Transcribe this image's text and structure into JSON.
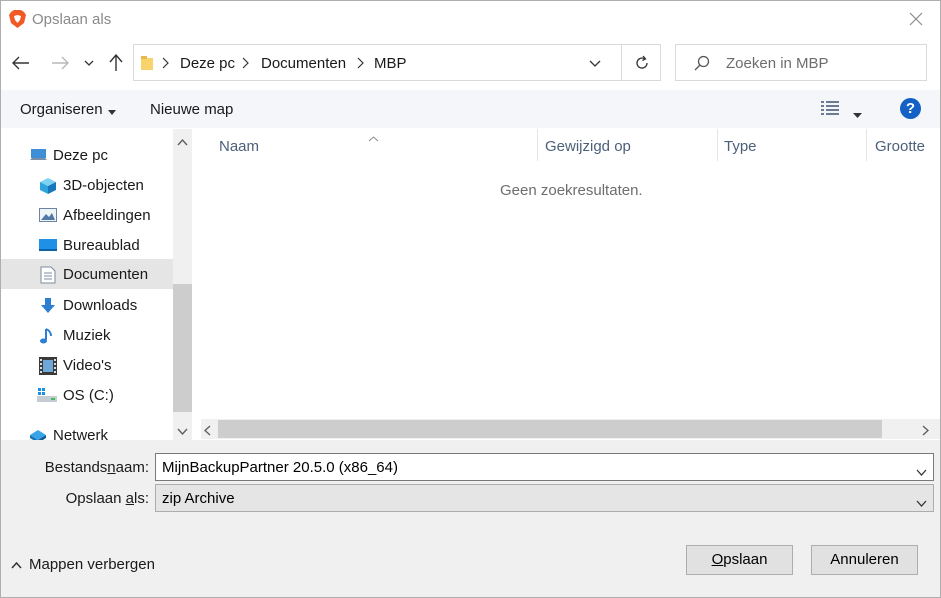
{
  "window": {
    "title": "Opslaan als"
  },
  "breadcrumb": [
    "Deze pc",
    "Documenten",
    "MBP"
  ],
  "search": {
    "placeholder": "Zoeken in MBP"
  },
  "toolbar": {
    "organize_label": "Organiseren",
    "new_folder_label": "Nieuwe map",
    "help_label": "?"
  },
  "nav": {
    "items": [
      {
        "label": "Deze pc",
        "icon": "computer-icon"
      },
      {
        "label": "3D-objecten",
        "icon": "cube-icon"
      },
      {
        "label": "Afbeeldingen",
        "icon": "pictures-icon"
      },
      {
        "label": "Bureaublad",
        "icon": "desktop-icon"
      },
      {
        "label": "Documenten",
        "icon": "document-icon",
        "selected": true
      },
      {
        "label": "Downloads",
        "icon": "download-icon"
      },
      {
        "label": "Muziek",
        "icon": "music-icon"
      },
      {
        "label": "Video's",
        "icon": "video-icon"
      },
      {
        "label": "OS (C:)",
        "icon": "drive-icon"
      },
      {
        "label": "Netwerk",
        "icon": "network-icon"
      }
    ]
  },
  "list": {
    "columns": [
      "Naam",
      "Gewijzigd op",
      "Type",
      "Grootte"
    ],
    "empty_text": "Geen zoekresultaten."
  },
  "form": {
    "filename_label_pre": "Bestands",
    "filename_label_u": "n",
    "filename_label_post": "aam:",
    "filename_value": "MijnBackupPartner 20.5.0 (x86_64)",
    "type_label_pre": "Opslaan ",
    "type_label_u": "a",
    "type_label_post": "ls:",
    "type_value": "zip Archive"
  },
  "footer": {
    "toggle_label": "Mappen verbergen",
    "save_u": "O",
    "save_rest": "pslaan",
    "cancel_label": "Annuleren"
  },
  "colors": {
    "accent": "#1460c4",
    "selected_bg": "#e5e5e5",
    "bottom_bg": "#f0f0f0"
  }
}
